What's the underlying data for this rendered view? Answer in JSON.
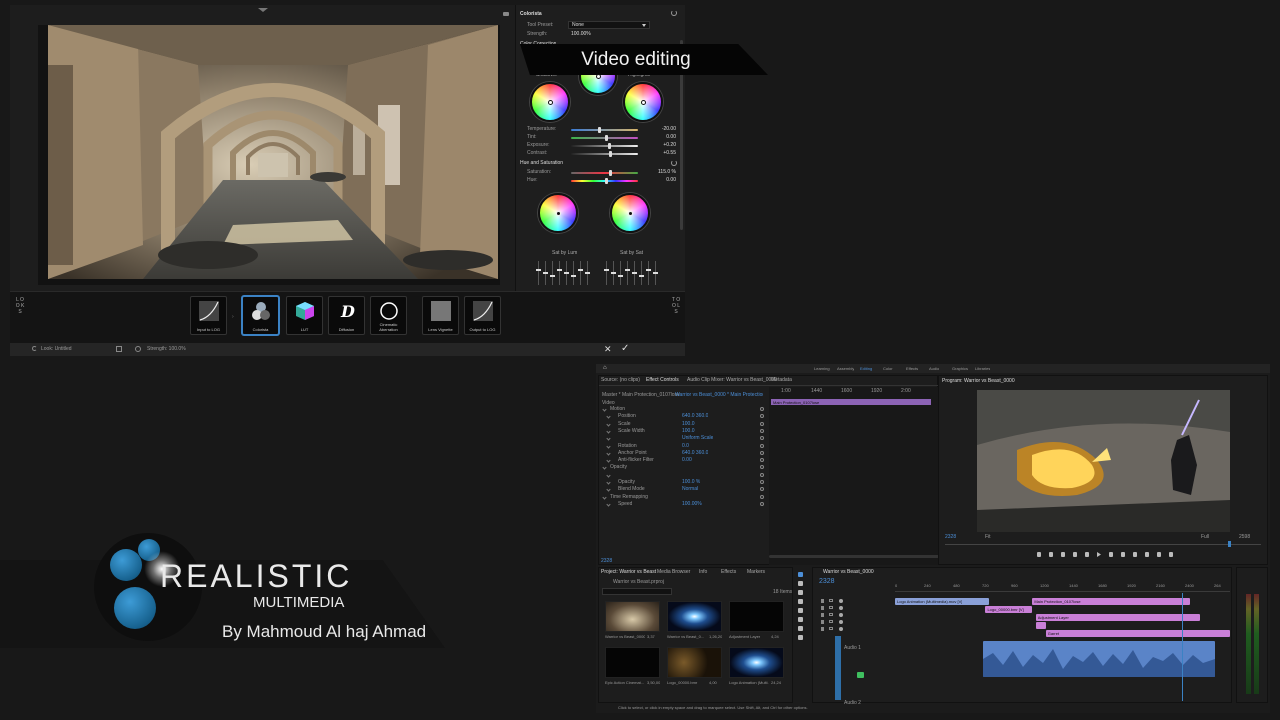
{
  "badge": {
    "text": "Video editing"
  },
  "logo": {
    "brand": "REALISTIC",
    "sub": "MULTIMEDIA",
    "author": "By Mahmoud Al haj Ahmad"
  },
  "colorist": {
    "title": "Colorista",
    "tool_preset_label": "Tool Preset:",
    "tool_preset_value": "None",
    "strength_label": "Strength:",
    "strength_value": "100.00%",
    "color_correction": "Color Correction",
    "shadows": "Shadows",
    "highlights": "Highlights",
    "sliders": [
      {
        "label": "Temperature:",
        "value": "-20.00",
        "pos": 0.4,
        "color": "linear-gradient(90deg,#3a7bd5,#d8b56a)"
      },
      {
        "label": "Tint:",
        "value": "0.00",
        "pos": 0.5,
        "color": "linear-gradient(90deg,#3db34a,#c24fc2)"
      },
      {
        "label": "Exposure:",
        "value": "+0.20",
        "pos": 0.55,
        "color": "linear-gradient(90deg,#222,#eee)"
      },
      {
        "label": "Contrast:",
        "value": "+0.55",
        "pos": 0.57,
        "color": "linear-gradient(90deg,#222,#eee)"
      }
    ],
    "hue_sat": "Hue and Saturation",
    "sat_sliders": [
      {
        "label": "Saturation:",
        "value": "115.0 %",
        "pos": 0.57,
        "color": "linear-gradient(90deg,#666,#e34,#4a4)"
      },
      {
        "label": "Hue:",
        "value": "0.00",
        "pos": 0.5,
        "color": "linear-gradient(90deg,#f33,#ff3,#3f3,#3ff,#33f,#f3f,#f33)"
      }
    ],
    "sat_by_lum": "Sat by Lum",
    "sat_by_sat": "Sat by Sat"
  },
  "tools": {
    "looks": "L O O K S",
    "tools": "T O O L S",
    "items": [
      {
        "label": "Input to LOG",
        "icon": "curve-icon"
      },
      {
        "label": "Colorista",
        "icon": "colorista-icon",
        "selected": true
      },
      {
        "label": "LUT",
        "icon": "lut-cube-icon"
      },
      {
        "label": "Diffusion",
        "icon": "diffusion-icon"
      },
      {
        "label": "Cinematic Aberration",
        "icon": "ring-icon"
      },
      {
        "label": "Lens Vignette",
        "icon": "vignette-icon"
      },
      {
        "label": "Output to LOG",
        "icon": "curve-icon"
      }
    ]
  },
  "status": {
    "look": "Look: Untitled",
    "strength": "Strength: 100.0%"
  },
  "premiere": {
    "workspaces": [
      "Learning",
      "Assembly",
      "Editing",
      "Color",
      "Effects",
      "Audio",
      "Graphics",
      "Libraries"
    ],
    "source_tabs": [
      "Source: (no clips)",
      "Effect Controls",
      "Audio Clip Mixer: Warrior vs Beast_0000",
      "Metadata"
    ],
    "clip_path": "Master * Main Protection_0107lose",
    "seq_path": "Warrior vs Beast_0000 * Main Protection_010...",
    "ruler": [
      "1:00",
      "1440",
      "1600",
      "1920",
      "2:00"
    ],
    "clip_bar": "Main Protection_0107lose",
    "video_label": "Video",
    "fx": [
      {
        "name": "Motion",
        "val": "",
        "indent": 0
      },
      {
        "name": "Position",
        "val": "640.0   360.0",
        "indent": 1
      },
      {
        "name": "Scale",
        "val": "100.0",
        "indent": 1
      },
      {
        "name": "Scale Width",
        "val": "100.0",
        "indent": 1
      },
      {
        "name": "",
        "val": "Uniform Scale",
        "indent": 1
      },
      {
        "name": "Rotation",
        "val": "0.0",
        "indent": 1
      },
      {
        "name": "Anchor Point",
        "val": "640.0   360.0",
        "indent": 1
      },
      {
        "name": "Anti-flicker Filter",
        "val": "0.00",
        "indent": 1
      },
      {
        "name": "Opacity",
        "val": "",
        "indent": 0
      },
      {
        "name": "",
        "val": "",
        "indent": 1
      },
      {
        "name": "Opacity",
        "val": "100.0 %",
        "indent": 1
      },
      {
        "name": "Blend Mode",
        "val": "Normal",
        "indent": 1
      },
      {
        "name": "Time Remapping",
        "val": "",
        "indent": 0
      },
      {
        "name": "Speed",
        "val": "100.00%",
        "indent": 1
      }
    ],
    "fx_timecode": "2328",
    "program_title": "Program: Warrior vs Beast_0000",
    "program_tc": "2328",
    "program_fit": "Fit",
    "program_full": "Full",
    "program_end": "2598",
    "project_tabs": [
      "Project: Warrior vs Beast",
      "Media Browser",
      "Info",
      "Effects",
      "Markers"
    ],
    "project_file": "Warrior vs Beast.prproj",
    "items_count": "18 Items",
    "bins": [
      {
        "name": "Warrior vs Beast_0000...",
        "dur": "3,37",
        "kind": "hall"
      },
      {
        "name": "Warrior vs Beast_0...",
        "dur": "1,26,20",
        "kind": "flare"
      },
      {
        "name": "Adjustment Layer",
        "dur": "4,24",
        "kind": "black"
      },
      {
        "name": "Epic Action Cinemat...",
        "dur": "3,50,00",
        "kind": "black"
      },
      {
        "name": "Logo_00000.bmr",
        "dur": "4,00",
        "kind": "logo"
      },
      {
        "name": "Logo Animation (Multi...",
        "dur": "24,24",
        "kind": "flare"
      }
    ],
    "sequence_tab": "Warrior vs Beast_0000",
    "seq_tc": "2328",
    "seq_ruler": [
      "0",
      "240",
      "480",
      "720",
      "960",
      "1200",
      "1440",
      "1680",
      "1920",
      "2160",
      "2400",
      "264"
    ],
    "clips": [
      {
        "label": "Logo Animation (Multimedia).mov [V]",
        "color": "#8aa0d8",
        "track": 0,
        "start": 0.0,
        "end": 0.28
      },
      {
        "label": "Main Protection_0107lose",
        "color": "#c97fd7",
        "track": 0,
        "start": 0.41,
        "end": 0.88
      },
      {
        "label": "Logo_00000.bmr [V]",
        "color": "#c97fd7",
        "track": 1,
        "start": 0.27,
        "end": 0.41
      },
      {
        "label": "Adjustment Layer",
        "color": "#c97fd7",
        "track": 2,
        "start": 0.42,
        "end": 0.91
      },
      {
        "label": "",
        "color": "#c97fd7",
        "track": 3,
        "start": 0.42,
        "end": 0.45
      },
      {
        "label": "Garret",
        "color": "#c97fd7",
        "track": 4,
        "start": 0.45,
        "end": 1.0
      }
    ],
    "audio_label": "Audio 1",
    "audio2_label": "Audio 2",
    "status_text": "Click to select, or click in empty space and drag to marquee select. Use Shift, Alt, and Ctrl for other options."
  }
}
